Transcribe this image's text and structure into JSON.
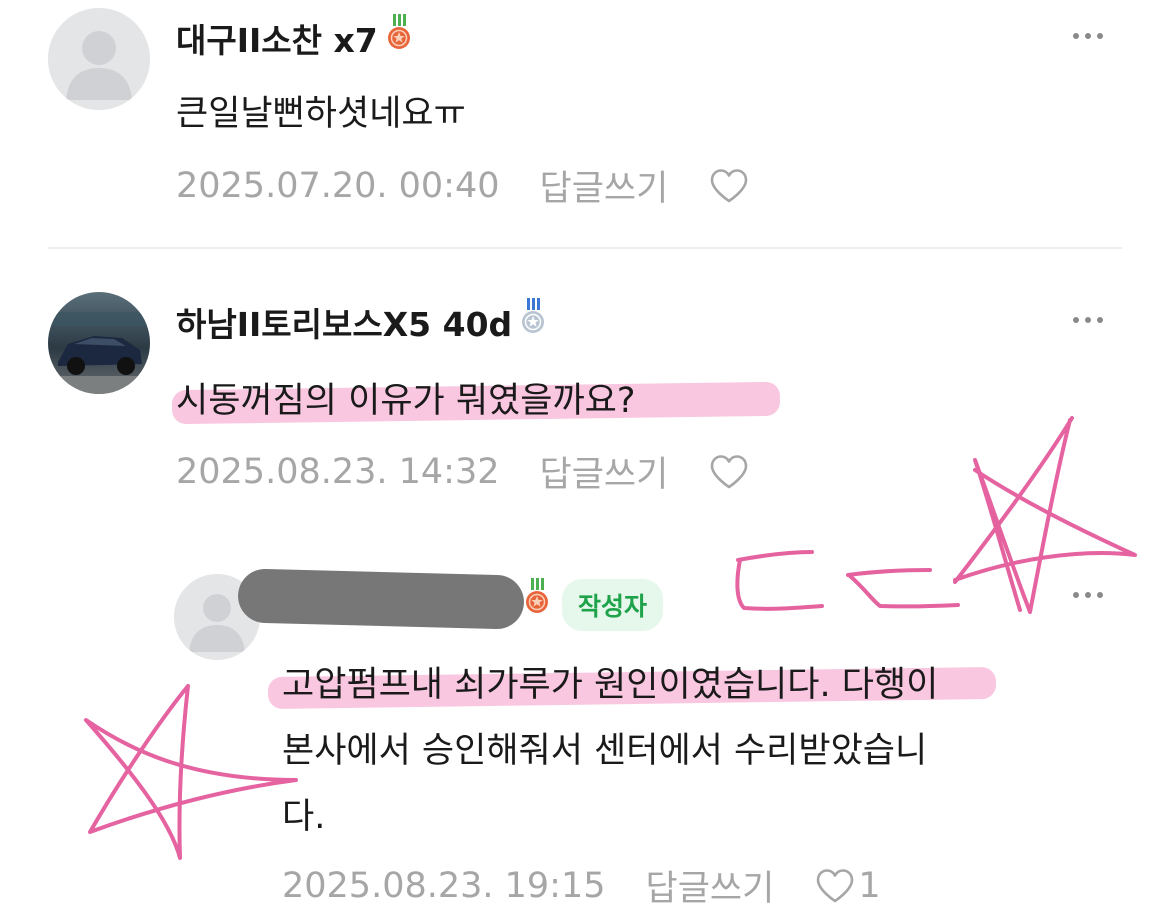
{
  "comments": [
    {
      "author": "대구II소찬 x7",
      "body": "큰일날뻔하셧네요ㅠ",
      "date": "2025.07.20. 00:40",
      "reply_label": "답글쓰기",
      "like_count": ""
    },
    {
      "author": "하남II토리보스X5 40d",
      "body": "시동꺼짐의 이유가 뭐였을까요?",
      "date": "2025.08.23. 14:32",
      "reply_label": "답글쓰기",
      "like_count": ""
    },
    {
      "author": "",
      "badge": "작성자",
      "body_line1": "고압펌프내 쇠가루가 원인이였습니다. 다행이",
      "body_line2": "본사에서 승인해줘서 센터에서 수리받았습니",
      "body_line3": "다.",
      "date": "2025.08.23. 19:15",
      "reply_label": "답글쓰기",
      "like_count": "1"
    }
  ],
  "icons": {
    "more": "more-dots-icon",
    "like": "heart-outline-icon",
    "medal_bronze": "bronze-medal-icon",
    "medal_silver": "silver-medal-icon",
    "avatar_default": "default-avatar-icon"
  },
  "colors": {
    "text": "#1a1a1a",
    "meta": "#a6a6a6",
    "badge_bg": "#e6f7ec",
    "badge_text": "#1fa34a",
    "annotation_pink": "#e0488f",
    "medal_bronze": "#e8653c",
    "medal_silver": "#8fa3bf"
  }
}
